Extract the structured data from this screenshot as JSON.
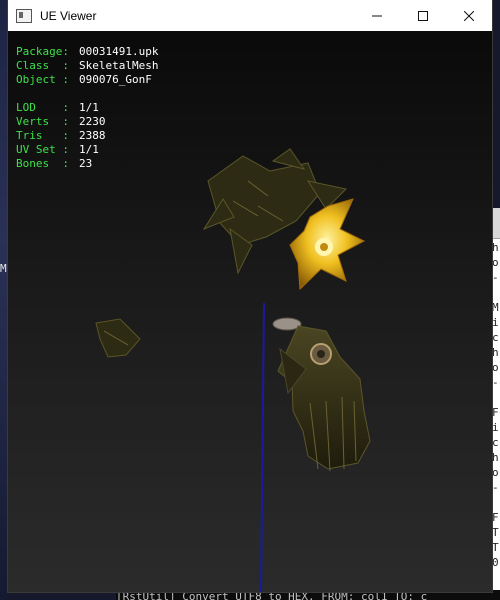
{
  "window": {
    "title": "UE Viewer",
    "controls": {
      "minimize_icon": "minimize-icon",
      "maximize_icon": "maximize-icon",
      "close_icon": "close-icon"
    }
  },
  "info_panel": {
    "group1": [
      {
        "key": "Package:",
        "value": "00031491.upk"
      },
      {
        "key": "Class  :",
        "value": "SkeletalMesh"
      },
      {
        "key": "Object :",
        "value": "090076_GonF"
      }
    ],
    "group2": [
      {
        "key": "LOD    :",
        "value": "1/1"
      },
      {
        "key": "Verts  :",
        "value": "2230"
      },
      {
        "key": "Tris   :",
        "value": "2388"
      },
      {
        "key": "UV Set :",
        "value": "1/1"
      },
      {
        "key": "Bones  :",
        "value": "23"
      }
    ]
  },
  "background": {
    "console_text": "[RstUtil] Convert UTF8 to HEX. FROM: col1  TO: c",
    "left_glyph": "M",
    "right_chars": [
      "h",
      "o",
      "-",
      "",
      "M",
      "i",
      "c",
      "h",
      "o",
      "-",
      "",
      "F",
      "i",
      "c",
      "h",
      "o",
      "-",
      "",
      "F",
      "T",
      "T",
      "0"
    ]
  },
  "colors": {
    "label": "#3fe04a",
    "value": "#ffffff",
    "axis": "#1a1aa0",
    "flower_gold": "#f0c020"
  }
}
